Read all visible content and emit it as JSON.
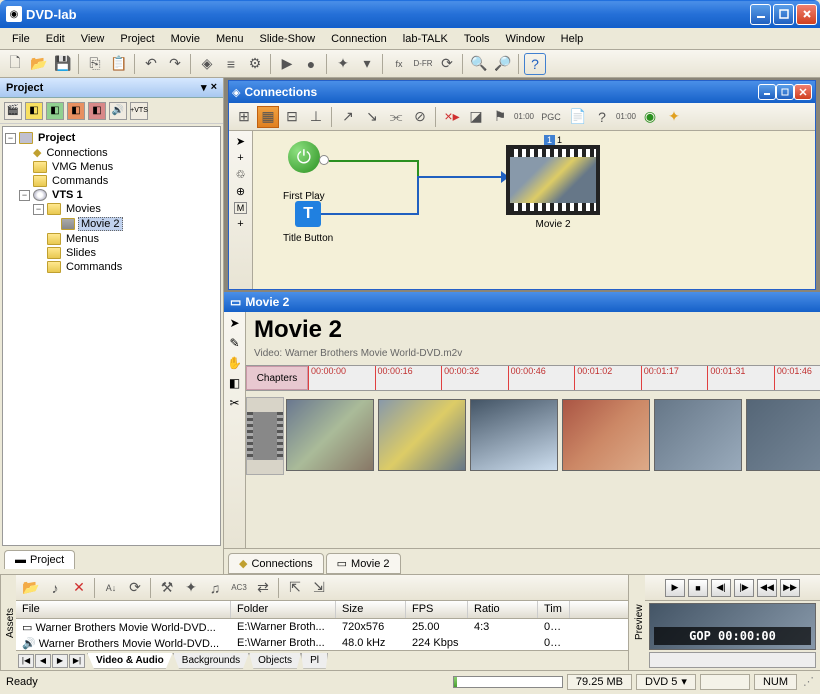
{
  "titlebar": {
    "text": "DVD-lab"
  },
  "menu": [
    "File",
    "Edit",
    "View",
    "Project",
    "Movie",
    "Menu",
    "Slide-Show",
    "Connection",
    "lab-TALK",
    "Tools",
    "Window",
    "Help"
  ],
  "project": {
    "title": "Project",
    "root": "Project",
    "nodes": {
      "connections": "Connections",
      "vmg": "VMG Menus",
      "commands": "Commands",
      "vts1": "VTS 1",
      "movies": "Movies",
      "movie2": "Movie 2",
      "menus": "Menus",
      "slides": "Slides",
      "commands2": "Commands"
    },
    "tab": "Project"
  },
  "connections": {
    "title": "Connections",
    "first_play": "First Play",
    "title_button": "Title Button",
    "movie_label": "Movie 2",
    "index_small": "1",
    "index": "1",
    "pgc": "PGC"
  },
  "movie": {
    "title": "Movie 2",
    "heading": "Movie 2",
    "path": "Video: Warner Brothers Movie World-DVD.m2v",
    "chapters_label": "Chapters",
    "marks": [
      "00:00:00",
      "00:00:16",
      "00:00:32",
      "00:00:46",
      "00:01:02",
      "00:01:17",
      "00:01:31",
      "00:01:46"
    ]
  },
  "mdi_tabs": {
    "connections": "Connections",
    "movie": "Movie 2"
  },
  "assets": {
    "side": "Assets",
    "headers": {
      "file": "File",
      "folder": "Folder",
      "size": "Size",
      "fps": "FPS",
      "ratio": "Ratio",
      "tim": "Tim"
    },
    "rows": [
      {
        "file": "Warner Brothers Movie World-DVD...",
        "folder": "E:\\Warner Broth...",
        "size": "720x576",
        "fps": "25.00",
        "ratio": "4:3",
        "tim": "00:..."
      },
      {
        "file": "Warner Brothers Movie World-DVD...",
        "folder": "E:\\Warner Broth...",
        "size": "48.0 kHz",
        "fps": "224 Kbps",
        "ratio": "",
        "tim": "00:..."
      }
    ],
    "tabs": [
      "Video & Audio",
      "Backgrounds",
      "Objects",
      "Pl"
    ]
  },
  "preview": {
    "side": "Preview",
    "gop": "GOP 00:00:00"
  },
  "status": {
    "ready": "Ready",
    "size": "79.25 MB",
    "dvd": "DVD 5",
    "num": "NUM"
  }
}
